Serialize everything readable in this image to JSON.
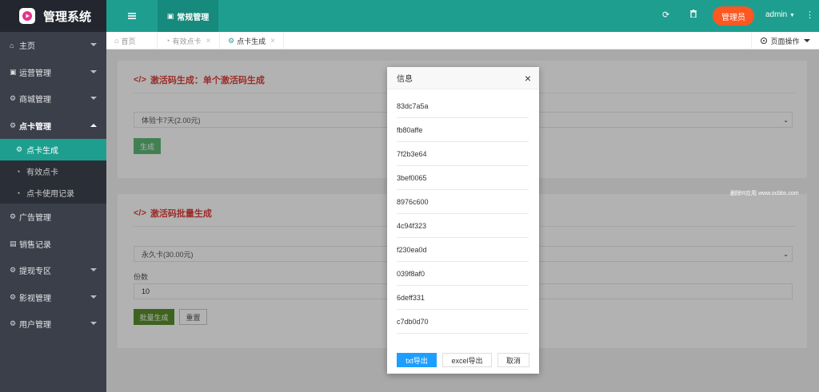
{
  "header": {
    "brand_title": "管理系统",
    "active_tab": "常规管理",
    "role_badge": "管理员",
    "username": "admin"
  },
  "sidebar": {
    "items": [
      {
        "label": "主页",
        "icon": "home-icon"
      },
      {
        "label": "运营管理",
        "icon": "window-icon"
      },
      {
        "label": "商城管理",
        "icon": "gears-icon"
      },
      {
        "label": "点卡管理",
        "icon": "gears-icon"
      },
      {
        "label": "广告管理",
        "icon": "gears-icon"
      },
      {
        "label": "销售记录",
        "icon": "file-icon"
      },
      {
        "label": "提现专区",
        "icon": "gears-icon"
      },
      {
        "label": "影视管理",
        "icon": "gears-icon"
      },
      {
        "label": "用户管理",
        "icon": "gears-icon"
      }
    ],
    "subitems": [
      {
        "label": "点卡生成",
        "icon": "gears-icon"
      },
      {
        "label": "有效点卡",
        "icon": "dashboard-icon"
      },
      {
        "label": "点卡使用记录",
        "icon": "dashboard-icon"
      }
    ]
  },
  "tabs": [
    {
      "label": "首页"
    },
    {
      "label": "有效点卡"
    },
    {
      "label": "点卡生成"
    }
  ],
  "page_ops_label": "页面操作",
  "single_card": {
    "title": "激活码生成：单个激活码生成",
    "select_value": "体验卡7天(2.00元)",
    "generate_label": "生成"
  },
  "batch_card": {
    "title": "激活码批量生成",
    "select_value": "永久卡(30.00元)",
    "count_label": "份数",
    "count_value": "10",
    "batch_label": "批量生成",
    "reset_label": "重置"
  },
  "watermark": "删除R应用 www.ocbbs.com",
  "dialog": {
    "title": "信息",
    "codes": [
      "83dc7a5a",
      "fb80affe",
      "7f2b3e64",
      "3bef0065",
      "8976c600",
      "4c94f323",
      "f230ea0d",
      "039f8af0",
      "6deff331",
      "c7db0d70"
    ],
    "txt_export": "txt导出",
    "excel_export": "excel导出",
    "cancel": "取消"
  },
  "colors": {
    "accent": "#1e9e8f",
    "brand_bg": "#23262e",
    "sidebar_bg": "#3a3f4a",
    "badge": "#ff5722",
    "title_red": "#e0403b",
    "button_green": "#5fb878",
    "button_blue": "#1e9fff"
  }
}
